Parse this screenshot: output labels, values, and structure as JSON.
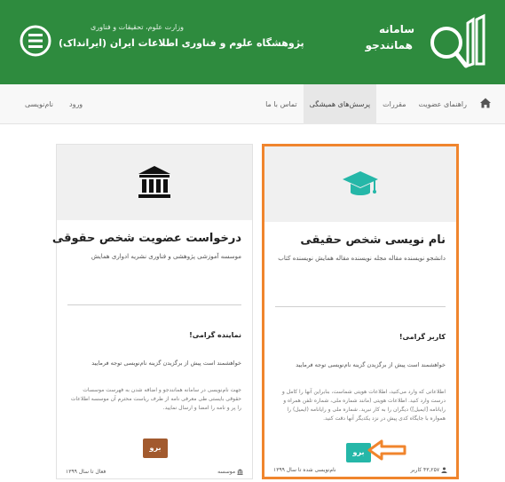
{
  "header": {
    "institute_line1": "وزارت علوم، تحقیقات و فناوری",
    "institute_line2": "پژوهشگاه علوم و فناوری اطلاعات ایران (ایرانداک)",
    "system_name_line1": "سامانه",
    "system_name_line2": "همانندجو",
    "brand_color": "#2e8b3e"
  },
  "nav": {
    "home_icon": "home-icon",
    "items": [
      {
        "label": "راهنمای عضویت"
      },
      {
        "label": "مقررات"
      },
      {
        "label": "پرسش‌های همیشگی"
      },
      {
        "label": "تماس با ما"
      }
    ],
    "register_label": "نام‌نویسی",
    "login_label": "ورود"
  },
  "cards": {
    "natural": {
      "title": "نام نویسی شخص حقیقی",
      "subtitle": "دانشجو  نویسنده مقاله مجله  نویسنده مقاله همایش  نویسنده کتاب",
      "greeting": "کاربر گرامی!",
      "note": "خواهشمند است پیش از برگزیدن گزینه نام‌نویسی توجه فرمایید",
      "description": "اطلاعاتی که وارد می‌کنید، اطلاعات هویتی شماست، بنابراین آنها را کامل و درست وارد کنید. اطلاعات هویتی (مانند شماره ملی، شماره تلفن همراه و رایانامه [ایمیل]) دیگران را به کار نبرید. شماره ملی و رایانامه (ایمیل) را همواره با جایگاه کدی پیش در نزد یکدیگر آنها دقت کنید.",
      "button_label": "برو",
      "footer_count": "۴۳,۲۵۷ کاربر",
      "footer_since": "نام‌نویسی شده تا سال ۱۳۹۹",
      "accent_color": "#25b7a8"
    },
    "legal": {
      "title": "درخواست عضویت شخص حقوقی",
      "subtitle": "موسسه آموزشی پژوهشی و فناوری  نشریه ادواری  همایش",
      "greeting": "نماینده گرامی!",
      "note": "خواهشمند است پیش از برگزیدن گزینه نام‌نویسی توجه فرمایید",
      "description": "جهت نام‌نویسی در سامانه همانندجو و اضافه شدن به فهرست موسسات حقوقی بایستی طی معرفی نامه از طرف ریاست محترم آن موسسه اطلاعات را پر و نامه را امضا و ارسال نمایید.",
      "button_label": "برو",
      "footer_count": "موسسه",
      "footer_since": "فعال تا سال ۱۳۹۹",
      "accent_color": "#a25a2e"
    }
  }
}
